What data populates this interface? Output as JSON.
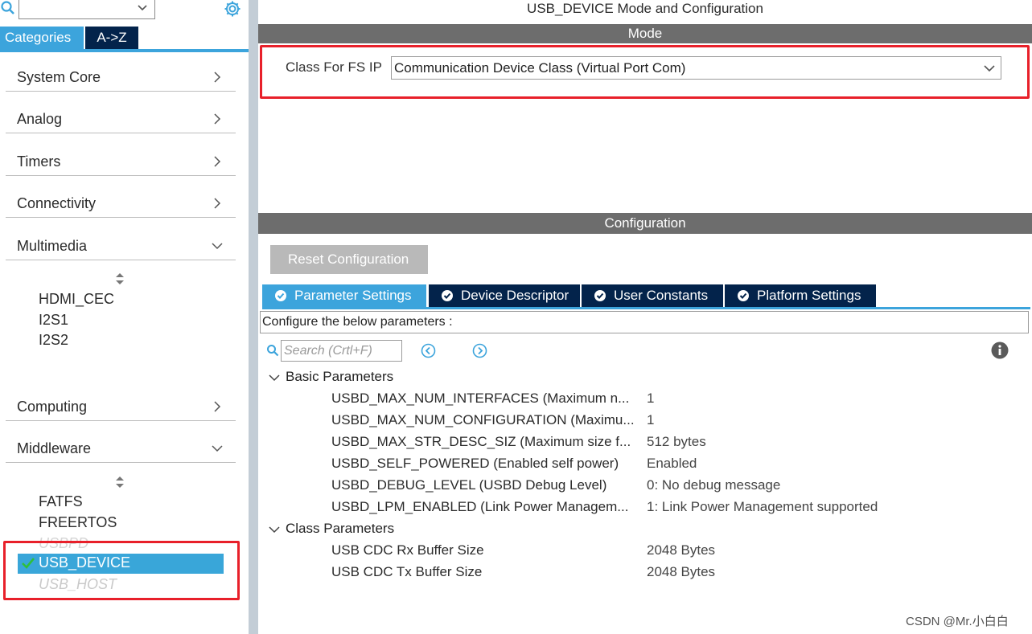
{
  "left": {
    "tabs": {
      "categories": "Categories",
      "az": "A->Z"
    },
    "categories": [
      {
        "label": "System Core",
        "expanded": false
      },
      {
        "label": "Analog",
        "expanded": false
      },
      {
        "label": "Timers",
        "expanded": false
      },
      {
        "label": "Connectivity",
        "expanded": false
      },
      {
        "label": "Multimedia",
        "expanded": true
      },
      {
        "label": "Computing",
        "expanded": false
      },
      {
        "label": "Middleware",
        "expanded": true
      }
    ],
    "multimedia_items": [
      "HDMI_CEC",
      "I2S1",
      "I2S2"
    ],
    "middleware_items": [
      "FATFS",
      "FREERTOS",
      "USBPD",
      "USB_DEVICE",
      "USB_HOST"
    ],
    "selected_item": "USB_DEVICE"
  },
  "right": {
    "title": "USB_DEVICE Mode and Configuration",
    "mode_bar": "Mode",
    "class_label": "Class For FS IP",
    "class_value": "Communication Device Class (Virtual Port Com)",
    "config_bar": "Configuration",
    "reset_button": "Reset Configuration",
    "tabs": [
      "Parameter Settings",
      "Device Descriptor",
      "User Constants",
      "Platform Settings"
    ],
    "configure_text": "Configure the below parameters :",
    "search_placeholder": "Search (Crtl+F)",
    "groups": [
      {
        "name": "Basic Parameters",
        "params": [
          {
            "name": "USBD_MAX_NUM_INTERFACES (Maximum n...",
            "value": "1"
          },
          {
            "name": "USBD_MAX_NUM_CONFIGURATION (Maximu...",
            "value": "1"
          },
          {
            "name": "USBD_MAX_STR_DESC_SIZ (Maximum size f...",
            "value": "512 bytes"
          },
          {
            "name": "USBD_SELF_POWERED (Enabled self power)",
            "value": "Enabled"
          },
          {
            "name": "USBD_DEBUG_LEVEL (USBD Debug Level)",
            "value": "0: No debug message"
          },
          {
            "name": "USBD_LPM_ENABLED (Link Power Managem...",
            "value": "1: Link Power Management supported"
          }
        ]
      },
      {
        "name": "Class Parameters",
        "params": [
          {
            "name": "USB CDC Rx Buffer Size",
            "value": "2048 Bytes"
          },
          {
            "name": "USB CDC Tx Buffer Size",
            "value": "2048 Bytes"
          }
        ]
      }
    ]
  },
  "watermark": "CSDN @Mr.小白白",
  "colors": {
    "accent": "#3ca4dc",
    "dark_tab": "#03234b",
    "bar": "#6d6d6d",
    "highlight": "#e8202a"
  }
}
